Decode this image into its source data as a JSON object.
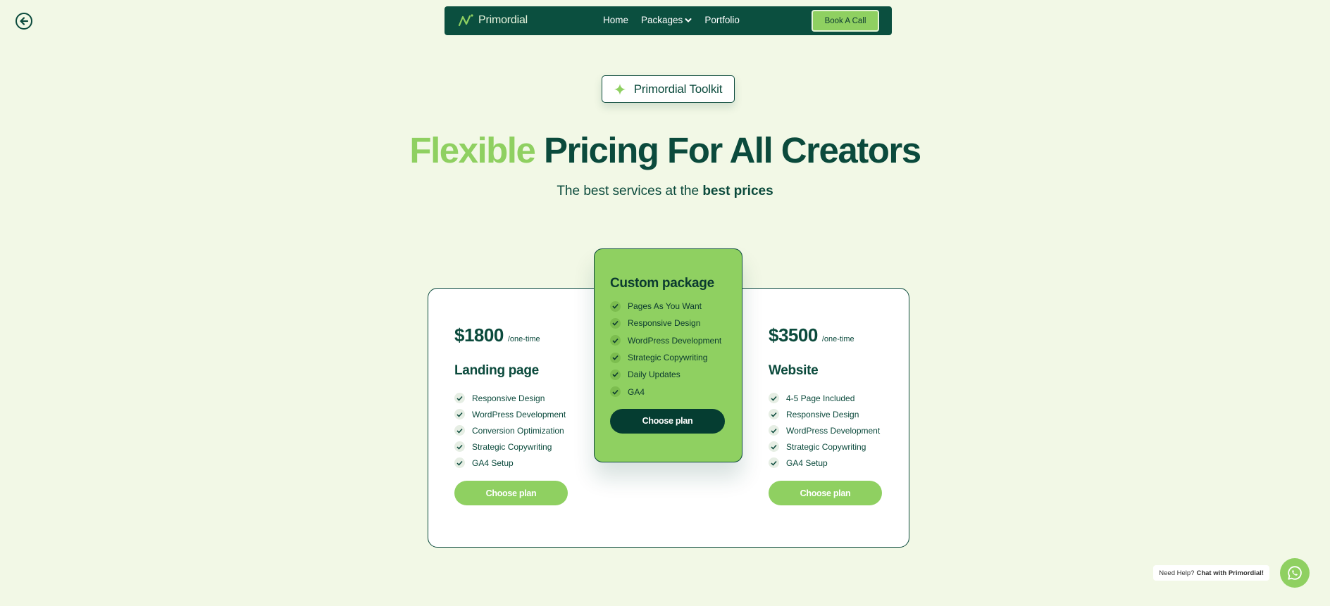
{
  "nav": {
    "brand": "Primordial",
    "links": [
      {
        "label": "Home"
      },
      {
        "label": "Packages"
      },
      {
        "label": "Portfolio"
      }
    ],
    "cta": "Book A Call"
  },
  "hero": {
    "badge": "Primordial Toolkit",
    "title_accent": "Flexible",
    "title_rest": " Pricing For All Creators",
    "subtitle_prefix": "The best services at the ",
    "subtitle_bold": "best prices"
  },
  "plans": {
    "landing": {
      "price": "$1800",
      "per": "/one-time",
      "title": "Landing page",
      "features": [
        "Responsive Design",
        "WordPress Development",
        "Conversion Optimization",
        "Strategic Copywriting",
        "GA4 Setup"
      ],
      "button": "Choose plan"
    },
    "custom": {
      "title": "Custom package",
      "features": [
        "Pages As You Want",
        "Responsive Design",
        "WordPress Development",
        "Strategic Copywriting",
        "Daily Updates",
        "GA4"
      ],
      "button": "Choose plan"
    },
    "website": {
      "price": "$3500",
      "per": "/one-time",
      "title": "Website",
      "features": [
        "4-5 Page Included",
        "Responsive Design",
        "WordPress Development",
        "Strategic Copywriting",
        "GA4 Setup"
      ],
      "button": "Choose plan"
    }
  },
  "help": {
    "prefix": "Need Help?",
    "link": "Chat with Primordial!"
  },
  "colors": {
    "background": "#f2f8e6",
    "primary": "#0b4a3c",
    "accent": "#8fd061"
  },
  "icons": {
    "back": "arrow-left-circle-icon",
    "logo": "primordial-logo-icon",
    "dropdown": "chevron-down-icon",
    "sparkle": "sparkle-icon",
    "check": "check-icon",
    "whatsapp": "whatsapp-icon"
  }
}
